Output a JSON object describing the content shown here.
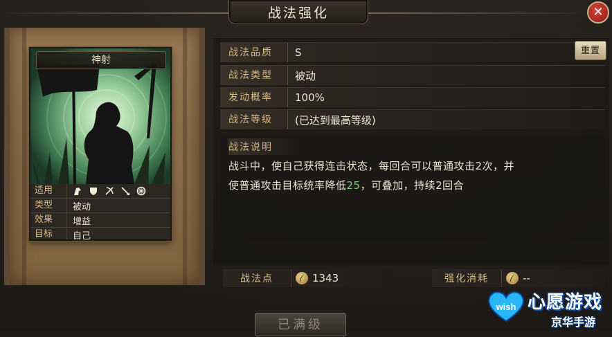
{
  "window": {
    "title": "战法强化",
    "close_label": "✕"
  },
  "card": {
    "name": "神射",
    "attributes": [
      {
        "key": "适用",
        "value": ""
      },
      {
        "key": "类型",
        "value": "被动"
      },
      {
        "key": "效果",
        "value": "增益"
      },
      {
        "key": "目标",
        "value": "自己"
      }
    ],
    "unit_icons": [
      "cavalry-icon",
      "shield-icon",
      "bow-icon",
      "spear-icon",
      "wheel-icon"
    ]
  },
  "details": {
    "quality_label": "战法品质",
    "quality_value": "S",
    "type_label": "战法类型",
    "type_value": "被动",
    "rate_label": "发动概率",
    "rate_value": "100%",
    "level_label": "战法等级",
    "level_value": "(已达到最高等级)",
    "reset_label": "重置"
  },
  "description": {
    "label": "战法说明",
    "line1": "战斗中，使自己获得连击状态，每回合可以普通攻击2次，并",
    "line2_prefix": "使普通攻击目标统率降低",
    "line2_number": "25",
    "line2_suffix": "，可叠加，持续2回合"
  },
  "points": {
    "points_label": "战法点",
    "points_value": "1343",
    "cost_label": "强化消耗",
    "cost_value": "--"
  },
  "bottom_button": "已满级",
  "watermark": {
    "brand": "心愿游戏",
    "sub": "京华手游",
    "logo_text": "wish"
  },
  "colors": {
    "accent_gold": "#d9b982",
    "green_number": "#7ccf73",
    "close_red": "#c0302a"
  }
}
